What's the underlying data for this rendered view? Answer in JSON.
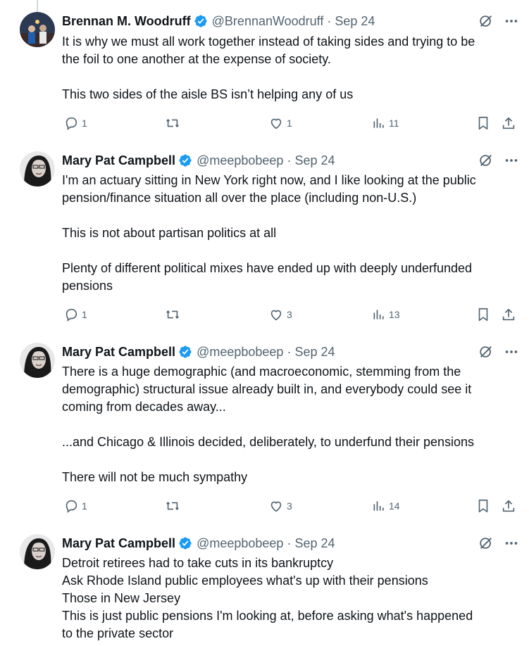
{
  "tweets": [
    {
      "name": "Brennan M. Woodruff",
      "handle": "@BrennanWoodruff",
      "date": "Sep 24",
      "lines": [
        "It is why we must all work together instead of taking sides and trying to be",
        "the foil to one another at the expense of society.",
        "",
        "This two sides of the aisle BS isn’t helping any of us"
      ],
      "replies": "1",
      "retweets": "",
      "likes": "1",
      "views": "11"
    },
    {
      "name": "Mary Pat Campbell",
      "handle": "@meepbobeep",
      "date": "Sep 24",
      "lines": [
        "I'm an actuary sitting in New York right now, and I like looking at the public",
        "pension/finance situation all over the place (including non-U.S.)",
        "",
        "This is not about partisan politics at all",
        "",
        "Plenty of different political mixes have ended up with deeply underfunded",
        "pensions"
      ],
      "replies": "1",
      "retweets": "",
      "likes": "3",
      "views": "13"
    },
    {
      "name": "Mary Pat Campbell",
      "handle": "@meepbobeep",
      "date": "Sep 24",
      "lines": [
        "There is a huge demographic (and macroeconomic, stemming from the",
        "demographic) structural issue already built in, and everybody could see it",
        "coming from decades away...",
        "",
        "...and Chicago & Illinois decided, deliberately, to underfund their pensions",
        "",
        "There will not be much sympathy"
      ],
      "replies": "1",
      "retweets": "",
      "likes": "3",
      "views": "14"
    },
    {
      "name": "Mary Pat Campbell",
      "handle": "@meepbobeep",
      "date": "Sep 24",
      "lines": [
        "Detroit retirees had to take cuts in its bankruptcy",
        "Ask Rhode Island public employees what's up with their pensions",
        "Those in New Jersey",
        "This is just public pensions I'm looking at, before asking what's happened",
        "to the private sector"
      ]
    }
  ],
  "colors": {
    "text": "#0f1419",
    "secondary": "#536471",
    "verified": "#1d9bf0",
    "thread_line": "#cfd9de"
  },
  "icons": [
    "reply-icon",
    "retweet-icon",
    "like-icon",
    "views-icon",
    "bookmark-icon",
    "share-icon",
    "grok-icon",
    "more-icon",
    "verified-badge-icon"
  ]
}
